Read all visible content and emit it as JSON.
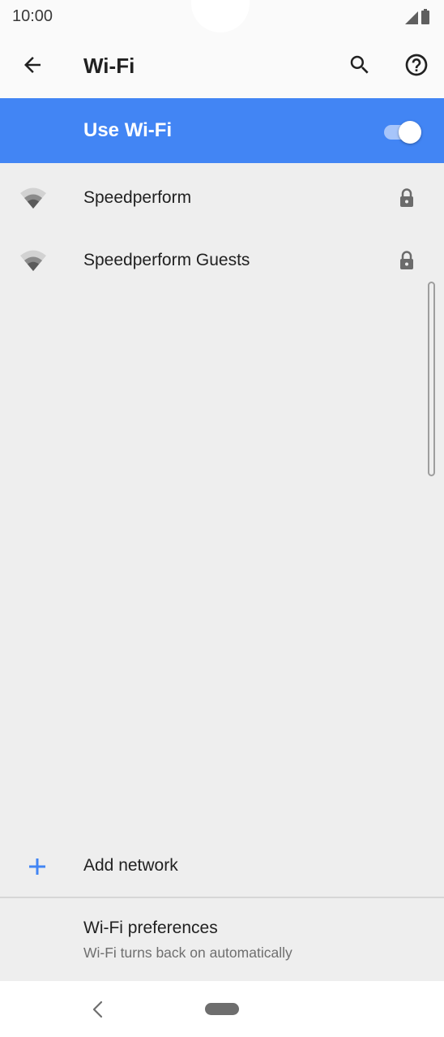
{
  "status_bar": {
    "time": "10:00",
    "icons": [
      "signal-icon",
      "battery-icon"
    ]
  },
  "app_bar": {
    "title": "Wi-Fi",
    "icons": [
      "back-arrow-icon",
      "search-icon",
      "help-icon"
    ]
  },
  "master_toggle": {
    "label": "Use Wi-Fi",
    "checked": true,
    "accent": "#4285f4"
  },
  "networks": [
    {
      "name": "Speedperform",
      "secured": true,
      "icon": "wifi-icon"
    },
    {
      "name": "Speedperform Guests",
      "secured": true,
      "icon": "wifi-icon"
    }
  ],
  "add_network": {
    "label": "Add network",
    "icon": "plus-icon",
    "icon_color": "#4285f4"
  },
  "preferences": {
    "title": "Wi-Fi preferences",
    "subtitle": "Wi-Fi turns back on automatically"
  },
  "nav_bar": {
    "icons": [
      "nav-back-icon",
      "home-pill"
    ]
  }
}
